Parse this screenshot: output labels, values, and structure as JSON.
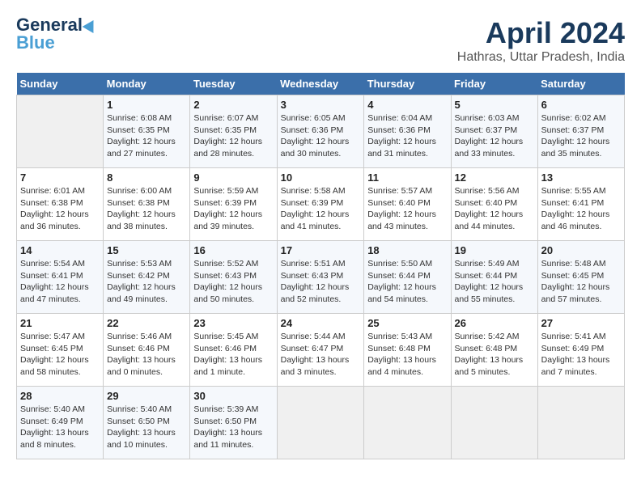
{
  "logo": {
    "line1": "General",
    "line2": "Blue"
  },
  "title": "April 2024",
  "location": "Hathras, Uttar Pradesh, India",
  "headers": [
    "Sunday",
    "Monday",
    "Tuesday",
    "Wednesday",
    "Thursday",
    "Friday",
    "Saturday"
  ],
  "weeks": [
    [
      {
        "day": "",
        "sunrise": "",
        "sunset": "",
        "daylight": ""
      },
      {
        "day": "1",
        "sunrise": "Sunrise: 6:08 AM",
        "sunset": "Sunset: 6:35 PM",
        "daylight": "Daylight: 12 hours and 27 minutes."
      },
      {
        "day": "2",
        "sunrise": "Sunrise: 6:07 AM",
        "sunset": "Sunset: 6:35 PM",
        "daylight": "Daylight: 12 hours and 28 minutes."
      },
      {
        "day": "3",
        "sunrise": "Sunrise: 6:05 AM",
        "sunset": "Sunset: 6:36 PM",
        "daylight": "Daylight: 12 hours and 30 minutes."
      },
      {
        "day": "4",
        "sunrise": "Sunrise: 6:04 AM",
        "sunset": "Sunset: 6:36 PM",
        "daylight": "Daylight: 12 hours and 31 minutes."
      },
      {
        "day": "5",
        "sunrise": "Sunrise: 6:03 AM",
        "sunset": "Sunset: 6:37 PM",
        "daylight": "Daylight: 12 hours and 33 minutes."
      },
      {
        "day": "6",
        "sunrise": "Sunrise: 6:02 AM",
        "sunset": "Sunset: 6:37 PM",
        "daylight": "Daylight: 12 hours and 35 minutes."
      }
    ],
    [
      {
        "day": "7",
        "sunrise": "Sunrise: 6:01 AM",
        "sunset": "Sunset: 6:38 PM",
        "daylight": "Daylight: 12 hours and 36 minutes."
      },
      {
        "day": "8",
        "sunrise": "Sunrise: 6:00 AM",
        "sunset": "Sunset: 6:38 PM",
        "daylight": "Daylight: 12 hours and 38 minutes."
      },
      {
        "day": "9",
        "sunrise": "Sunrise: 5:59 AM",
        "sunset": "Sunset: 6:39 PM",
        "daylight": "Daylight: 12 hours and 39 minutes."
      },
      {
        "day": "10",
        "sunrise": "Sunrise: 5:58 AM",
        "sunset": "Sunset: 6:39 PM",
        "daylight": "Daylight: 12 hours and 41 minutes."
      },
      {
        "day": "11",
        "sunrise": "Sunrise: 5:57 AM",
        "sunset": "Sunset: 6:40 PM",
        "daylight": "Daylight: 12 hours and 43 minutes."
      },
      {
        "day": "12",
        "sunrise": "Sunrise: 5:56 AM",
        "sunset": "Sunset: 6:40 PM",
        "daylight": "Daylight: 12 hours and 44 minutes."
      },
      {
        "day": "13",
        "sunrise": "Sunrise: 5:55 AM",
        "sunset": "Sunset: 6:41 PM",
        "daylight": "Daylight: 12 hours and 46 minutes."
      }
    ],
    [
      {
        "day": "14",
        "sunrise": "Sunrise: 5:54 AM",
        "sunset": "Sunset: 6:41 PM",
        "daylight": "Daylight: 12 hours and 47 minutes."
      },
      {
        "day": "15",
        "sunrise": "Sunrise: 5:53 AM",
        "sunset": "Sunset: 6:42 PM",
        "daylight": "Daylight: 12 hours and 49 minutes."
      },
      {
        "day": "16",
        "sunrise": "Sunrise: 5:52 AM",
        "sunset": "Sunset: 6:43 PM",
        "daylight": "Daylight: 12 hours and 50 minutes."
      },
      {
        "day": "17",
        "sunrise": "Sunrise: 5:51 AM",
        "sunset": "Sunset: 6:43 PM",
        "daylight": "Daylight: 12 hours and 52 minutes."
      },
      {
        "day": "18",
        "sunrise": "Sunrise: 5:50 AM",
        "sunset": "Sunset: 6:44 PM",
        "daylight": "Daylight: 12 hours and 54 minutes."
      },
      {
        "day": "19",
        "sunrise": "Sunrise: 5:49 AM",
        "sunset": "Sunset: 6:44 PM",
        "daylight": "Daylight: 12 hours and 55 minutes."
      },
      {
        "day": "20",
        "sunrise": "Sunrise: 5:48 AM",
        "sunset": "Sunset: 6:45 PM",
        "daylight": "Daylight: 12 hours and 57 minutes."
      }
    ],
    [
      {
        "day": "21",
        "sunrise": "Sunrise: 5:47 AM",
        "sunset": "Sunset: 6:45 PM",
        "daylight": "Daylight: 12 hours and 58 minutes."
      },
      {
        "day": "22",
        "sunrise": "Sunrise: 5:46 AM",
        "sunset": "Sunset: 6:46 PM",
        "daylight": "Daylight: 13 hours and 0 minutes."
      },
      {
        "day": "23",
        "sunrise": "Sunrise: 5:45 AM",
        "sunset": "Sunset: 6:46 PM",
        "daylight": "Daylight: 13 hours and 1 minute."
      },
      {
        "day": "24",
        "sunrise": "Sunrise: 5:44 AM",
        "sunset": "Sunset: 6:47 PM",
        "daylight": "Daylight: 13 hours and 3 minutes."
      },
      {
        "day": "25",
        "sunrise": "Sunrise: 5:43 AM",
        "sunset": "Sunset: 6:48 PM",
        "daylight": "Daylight: 13 hours and 4 minutes."
      },
      {
        "day": "26",
        "sunrise": "Sunrise: 5:42 AM",
        "sunset": "Sunset: 6:48 PM",
        "daylight": "Daylight: 13 hours and 5 minutes."
      },
      {
        "day": "27",
        "sunrise": "Sunrise: 5:41 AM",
        "sunset": "Sunset: 6:49 PM",
        "daylight": "Daylight: 13 hours and 7 minutes."
      }
    ],
    [
      {
        "day": "28",
        "sunrise": "Sunrise: 5:40 AM",
        "sunset": "Sunset: 6:49 PM",
        "daylight": "Daylight: 13 hours and 8 minutes."
      },
      {
        "day": "29",
        "sunrise": "Sunrise: 5:40 AM",
        "sunset": "Sunset: 6:50 PM",
        "daylight": "Daylight: 13 hours and 10 minutes."
      },
      {
        "day": "30",
        "sunrise": "Sunrise: 5:39 AM",
        "sunset": "Sunset: 6:50 PM",
        "daylight": "Daylight: 13 hours and 11 minutes."
      },
      {
        "day": "",
        "sunrise": "",
        "sunset": "",
        "daylight": ""
      },
      {
        "day": "",
        "sunrise": "",
        "sunset": "",
        "daylight": ""
      },
      {
        "day": "",
        "sunrise": "",
        "sunset": "",
        "daylight": ""
      },
      {
        "day": "",
        "sunrise": "",
        "sunset": "",
        "daylight": ""
      }
    ]
  ]
}
